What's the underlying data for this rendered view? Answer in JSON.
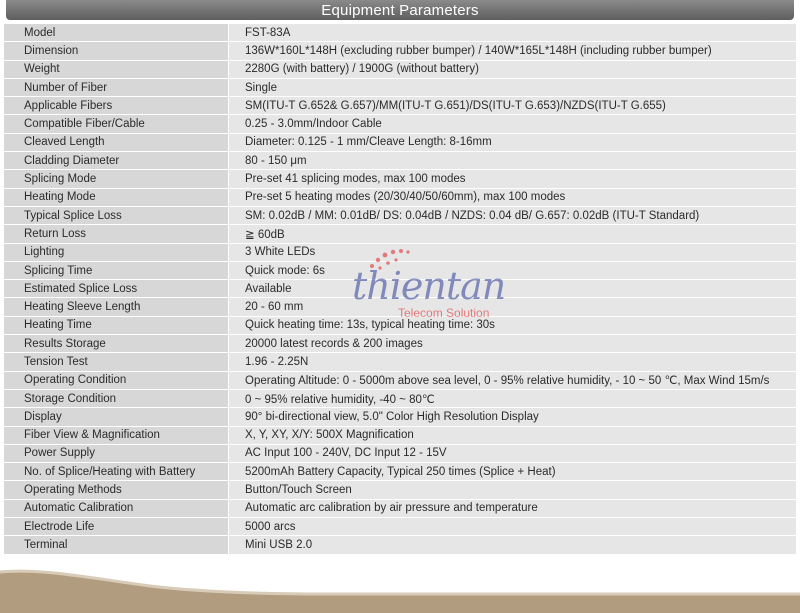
{
  "header": {
    "title": "Equipment Parameters"
  },
  "rows": [
    {
      "label": "Model",
      "value": "FST-83A"
    },
    {
      "label": "Dimension",
      "value": "136W*160L*148H (excluding rubber bumper) / 140W*165L*148H (including rubber bumper)"
    },
    {
      "label": "Weight",
      "value": "2280G (with battery) / 1900G (without battery)"
    },
    {
      "label": "Number of Fiber",
      "value": "Single"
    },
    {
      "label": "Applicable Fibers",
      "value": "SM(ITU-T G.652& G.657)/MM(ITU-T G.651)/DS(ITU-T G.653)/NZDS(ITU-T G.655)"
    },
    {
      "label": "Compatible Fiber/Cable",
      "value": "0.25 - 3.0mm/Indoor Cable"
    },
    {
      "label": "Cleaved Length",
      "value": "Diameter: 0.125 - 1 mm/Cleave Length: 8-16mm"
    },
    {
      "label": "Cladding Diameter",
      "value": "80 - 150 μm"
    },
    {
      "label": "Splicing Mode",
      "value": "Pre-set 41 splicing modes,  max 100 modes"
    },
    {
      "label": "Heating Mode",
      "value": "Pre-set 5 heating modes (20/30/40/50/60mm), max 100 modes"
    },
    {
      "label": "Typical Splice Loss",
      "value": "SM: 0.02dB / MM: 0.01dB/ DS: 0.04dB / NZDS: 0.04 dB/ G.657: 0.02dB (ITU-T Standard)"
    },
    {
      "label": "Return Loss",
      "value": "≧ 60dB"
    },
    {
      "label": "Lighting",
      "value": "3 White LEDs"
    },
    {
      "label": "Splicing Time",
      "value": "Quick mode: 6s"
    },
    {
      "label": "Estimated Splice Loss",
      "value": "Available"
    },
    {
      "label": "Heating Sleeve Length",
      "value": "20 - 60 mm"
    },
    {
      "label": "Heating Time",
      "value": "Quick heating time: 13s, typical heating time: 30s"
    },
    {
      "label": "Results Storage",
      "value": "20000 latest records & 200 images"
    },
    {
      "label": "Tension Test",
      "value": "1.96 - 2.25N"
    },
    {
      "label": "Operating Condition",
      "value": "Operating Altitude: 0 - 5000m above sea level, 0 - 95%  relative humidity,  - 10 ~ 50 ℃,   Max Wind 15m/s"
    },
    {
      "label": "Storage Condition",
      "value": "0 ~ 95% relative humidity, -40 ~ 80℃"
    },
    {
      "label": "Display",
      "value": "90° bi-directional view, 5.0\" Color High Resolution Display"
    },
    {
      "label": "Fiber View & Magnification",
      "value": "X, Y, XY, X/Y: 500X Magnification"
    },
    {
      "label": "Power Supply",
      "value": "AC Input 100 - 240V, DC Input 12 - 15V"
    },
    {
      "label": "No. of Splice/Heating with Battery",
      "value": "5200mAh Battery Capacity, Typical 250 times (Splice + Heat)"
    },
    {
      "label": "Operating Methods",
      "value": "Button/Touch Screen"
    },
    {
      "label": "Automatic Calibration",
      "value": "Automatic arc calibration by air pressure and temperature"
    },
    {
      "label": "Electrode Life",
      "value": "5000 arcs"
    },
    {
      "label": "Terminal",
      "value": "Mini USB 2.0"
    }
  ],
  "watermark": {
    "brand": "thientan",
    "tagline": "Telecom Solution"
  },
  "colors": {
    "header": "#6e6e6e",
    "label_bg": "#d7d7d7",
    "value_bg": "#e6e6e6",
    "footer": "#b29c80",
    "brand_blue": "#2f3e98",
    "brand_red": "#e02020"
  }
}
